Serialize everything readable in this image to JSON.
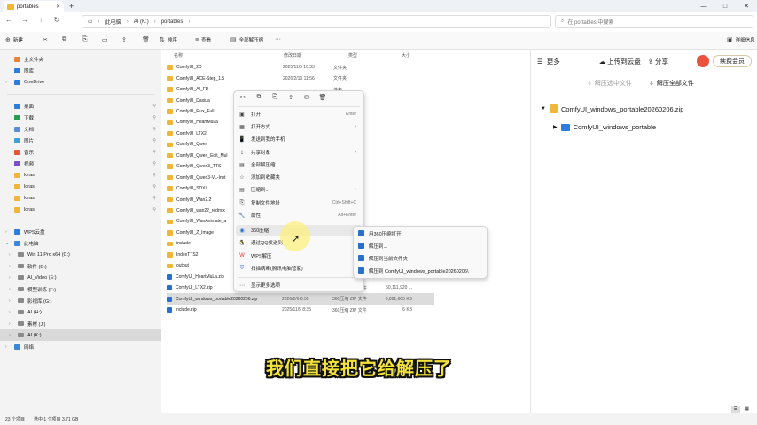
{
  "window": {
    "tab_title": "portables",
    "min_icon": "—",
    "max_icon": "□",
    "close_icon": "✕"
  },
  "address": {
    "crumbs": [
      "此电脑",
      "AI (K:)",
      "portables"
    ],
    "search_placeholder": "在 portables 中搜索"
  },
  "toolbar": {
    "new_label": "新建",
    "sort_label": "排序",
    "view_label": "查看",
    "extract_all_label": "全部解压缩",
    "details_label": "详细信息"
  },
  "sidebar": {
    "quick": [
      {
        "label": "主文件夹",
        "color": "#e8833a"
      },
      {
        "label": "图库",
        "color": "#2d7de0"
      }
    ],
    "onedrive": {
      "label": "OneDrive",
      "color": "#2d7de0"
    },
    "pinned": [
      {
        "label": "桌面",
        "color": "#2d7de0"
      },
      {
        "label": "下载",
        "color": "#2a9b54"
      },
      {
        "label": "文档",
        "color": "#5b8dd6"
      },
      {
        "label": "图片",
        "color": "#3fa0d9"
      },
      {
        "label": "音乐",
        "color": "#e5573d"
      },
      {
        "label": "视频",
        "color": "#7b4ec9"
      },
      {
        "label": "loras",
        "color": "#f0b63a"
      },
      {
        "label": "loras",
        "color": "#f0b63a"
      },
      {
        "label": "loras",
        "color": "#f0b63a"
      },
      {
        "label": "loras",
        "color": "#f0b63a"
      }
    ],
    "wps": {
      "label": "WPS云盘",
      "color": "#2d7de0"
    },
    "pc": {
      "label": "此电脑",
      "color": "#3b87d9"
    },
    "drives": [
      "Win 11 Pro x64 (C:)",
      "软件 (D:)",
      "AI_Video (E:)",
      "模型训练 (F:)",
      "影视库 (G:)",
      "AI (H:)",
      "素材 (J:)",
      "AI (K:)"
    ],
    "network": {
      "label": "网络",
      "color": "#3b87d9"
    }
  },
  "filelist": {
    "headers": {
      "name": "名称",
      "date": "修改日期",
      "type": "类型",
      "size": "大小"
    },
    "rows": [
      {
        "name": "ComfyUI_2D",
        "date": "2025/11/5 10:33",
        "type": "文件夹",
        "size": ""
      },
      {
        "name": "ComfyUI_ACE-Step_1.5",
        "date": "2026/2/10 11:56",
        "type": "文件夹",
        "size": ""
      },
      {
        "name": "ComfyUI_AI_FD",
        "date": "",
        "type": "件夹",
        "size": ""
      },
      {
        "name": "ComfyUI_Daxiua",
        "date": "",
        "type": "件夹",
        "size": ""
      },
      {
        "name": "ComfyUI_Flux_Full",
        "date": "",
        "type": "件夹",
        "size": ""
      },
      {
        "name": "ComfyUI_HeartMuLa",
        "date": "",
        "type": "件夹",
        "size": ""
      },
      {
        "name": "ComfyUI_LTX2",
        "date": "",
        "type": "件夹",
        "size": ""
      },
      {
        "name": "ComfyUI_Qwen",
        "date": "",
        "type": "件夹",
        "size": ""
      },
      {
        "name": "ComfyUI_Qwen_Edit_Mul",
        "date": "",
        "type": "件夹",
        "size": ""
      },
      {
        "name": "ComfyUI_Qwen3_TTS",
        "date": "",
        "type": "件夹",
        "size": ""
      },
      {
        "name": "ComfyUI_Qwen3-VL-Inst",
        "date": "",
        "type": "件夹",
        "size": ""
      },
      {
        "name": "ComfyUI_SDXL",
        "date": "",
        "type": "件夹",
        "size": ""
      },
      {
        "name": "ComfyUI_Wan2.2",
        "date": "",
        "type": "件夹",
        "size": ""
      },
      {
        "name": "ComfyUI_wan22_redmix",
        "date": "",
        "type": "件夹",
        "size": ""
      },
      {
        "name": "ComfyUI_WanAnimate_a",
        "date": "",
        "type": "件夹",
        "size": ""
      },
      {
        "name": "ComfyUI_Z_Image",
        "date": "",
        "type": "件夹",
        "size": ""
      },
      {
        "name": "include",
        "date": "",
        "type": "件夹",
        "size": ""
      },
      {
        "name": "IndexTTS2",
        "date": "",
        "type": "件夹",
        "size": ""
      },
      {
        "name": "output",
        "date": "",
        "type": "件夹",
        "size": ""
      },
      {
        "name": "ComfyUI_HeartMuLa.zip",
        "date": "",
        "type": "ZIP 文件",
        "size": ""
      },
      {
        "name": "ComfyUI_LTX2.zip",
        "date": "",
        "type": "360压缩 ZIP 文件",
        "size": "50,111,920 ..."
      },
      {
        "name": "ComfyUI_windows_portable20260206.zip",
        "date": "2026/2/6 8:55",
        "type": "360压缩 ZIP 文件",
        "size": "3,891,605 KB"
      },
      {
        "name": "include.zip",
        "date": "2025/11/5 8:35",
        "type": "360压缩 ZIP 文件",
        "size": "6 KB"
      }
    ]
  },
  "context_menu": {
    "icons": [
      "✂",
      "⧉",
      "⎘",
      "⇪",
      "✉",
      "🗑"
    ],
    "items": [
      {
        "label": "打开",
        "shortcut": "Enter",
        "arrow": "",
        "icon": "▣",
        "hl": false
      },
      {
        "label": "打开方式",
        "shortcut": "",
        "arrow": "›",
        "icon": "",
        "hl": false
      },
      {
        "label": "发送到我的手机",
        "shortcut": "",
        "arrow": "",
        "icon": "",
        "hl": false
      },
      {
        "label": "共享对象",
        "shortcut": "",
        "arrow": "›",
        "icon": "",
        "hl": false
      },
      {
        "label": "全部解压缩...",
        "shortcut": "",
        "arrow": "",
        "icon": "",
        "hl": false
      },
      {
        "label": "添加到收藏夹",
        "shortcut": "",
        "arrow": "",
        "icon": "",
        "hl": false
      },
      {
        "label": "压缩到...",
        "shortcut": "",
        "arrow": "›",
        "icon": "",
        "hl": false
      },
      {
        "label": "复制文件地址",
        "shortcut": "Ctrl+Shift+C",
        "arrow": "",
        "icon": "",
        "hl": false
      },
      {
        "label": "属性",
        "shortcut": "Alt+Enter",
        "arrow": "",
        "icon": "",
        "hl": false
      },
      {
        "label": "360压缩",
        "shortcut": "",
        "arrow": "›",
        "icon": "",
        "hl": true
      },
      {
        "label": "通过QQ发送到",
        "shortcut": "",
        "arrow": "",
        "icon": "",
        "hl": false
      },
      {
        "label": "WPS解压",
        "shortcut": "",
        "arrow": "›",
        "icon": "",
        "hl": false
      },
      {
        "label": "扫描病毒(腾讯电脑管家)",
        "shortcut": "",
        "arrow": "",
        "icon": "",
        "hl": false
      },
      {
        "label": "显示更多选项",
        "shortcut": "",
        "arrow": "",
        "icon": "",
        "hl": false
      }
    ]
  },
  "submenu": {
    "items": [
      "用360压缩打开",
      "解压到...",
      "解压到当前文件夹",
      "解压到 ComfyUI_windows_portable20260206\\"
    ]
  },
  "panel": {
    "more_label": "更多",
    "upload_label": "上传到云盘",
    "share_label": "分享",
    "member_label": "续费会员",
    "extract_selected_label": "解压选中文件",
    "extract_all_label": "解压全部文件",
    "zip_name": "ComfyUI_windows_portable20260206.zip",
    "folder_name": "ComfyUI_windows_portable"
  },
  "status": {
    "count": "23 个项目",
    "selection": "选中 1 个项目 3.71 GB"
  },
  "subtitle": "我们直接把它给解压了",
  "colors": {
    "folder": "#f0b63a",
    "subtitle": "#f2e23a",
    "accent_blue": "#2d7de0"
  }
}
